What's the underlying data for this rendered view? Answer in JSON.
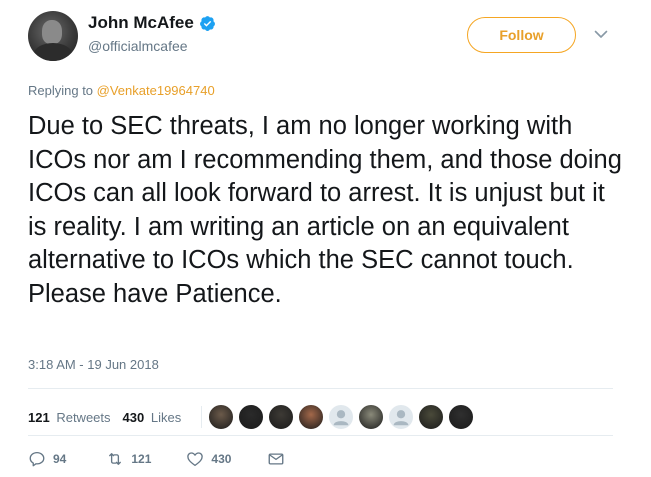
{
  "tweet": {
    "display_name": "John McAfee",
    "handle": "@officialmcafee",
    "follow_label": "Follow",
    "replying_to_prefix": "Replying to ",
    "replying_to_handle": "@Venkate19964740",
    "text": "Due to SEC threats, I am no longer working with ICOs nor am I recommending them, and those doing ICOs can all look forward to arrest. It is unjust but it is reality. I am writing an article on an equivalent alternative to ICOs which the SEC cannot touch. Please have Patience.",
    "timestamp": "3:18 AM - 19 Jun 2018"
  },
  "stats": {
    "retweets_count": "121",
    "retweets_label": "Retweets",
    "likes_count": "430",
    "likes_label": "Likes"
  },
  "likers": [
    {
      "icon": "avatar-photo",
      "color": "#6b5a4a"
    },
    {
      "icon": "avatar-photo",
      "color": "#2a2a2a"
    },
    {
      "icon": "avatar-photo",
      "color": "#3d3a35"
    },
    {
      "icon": "avatar-photo",
      "color": "#a3684a"
    },
    {
      "icon": "default-egg-avatar",
      "color": "#aab8c2"
    },
    {
      "icon": "avatar-photo",
      "color": "#8a8a7a"
    },
    {
      "icon": "default-egg-avatar",
      "color": "#aab8c2"
    },
    {
      "icon": "avatar-photo",
      "color": "#4a4a3a"
    },
    {
      "icon": "avatar-photo",
      "color": "#2f2f2f"
    }
  ],
  "actions": {
    "reply_count": "94",
    "retweet_count": "121",
    "like_count": "430"
  },
  "colors": {
    "accent": "#f5a623",
    "verified": "#1da1f2",
    "muted": "#657786"
  }
}
